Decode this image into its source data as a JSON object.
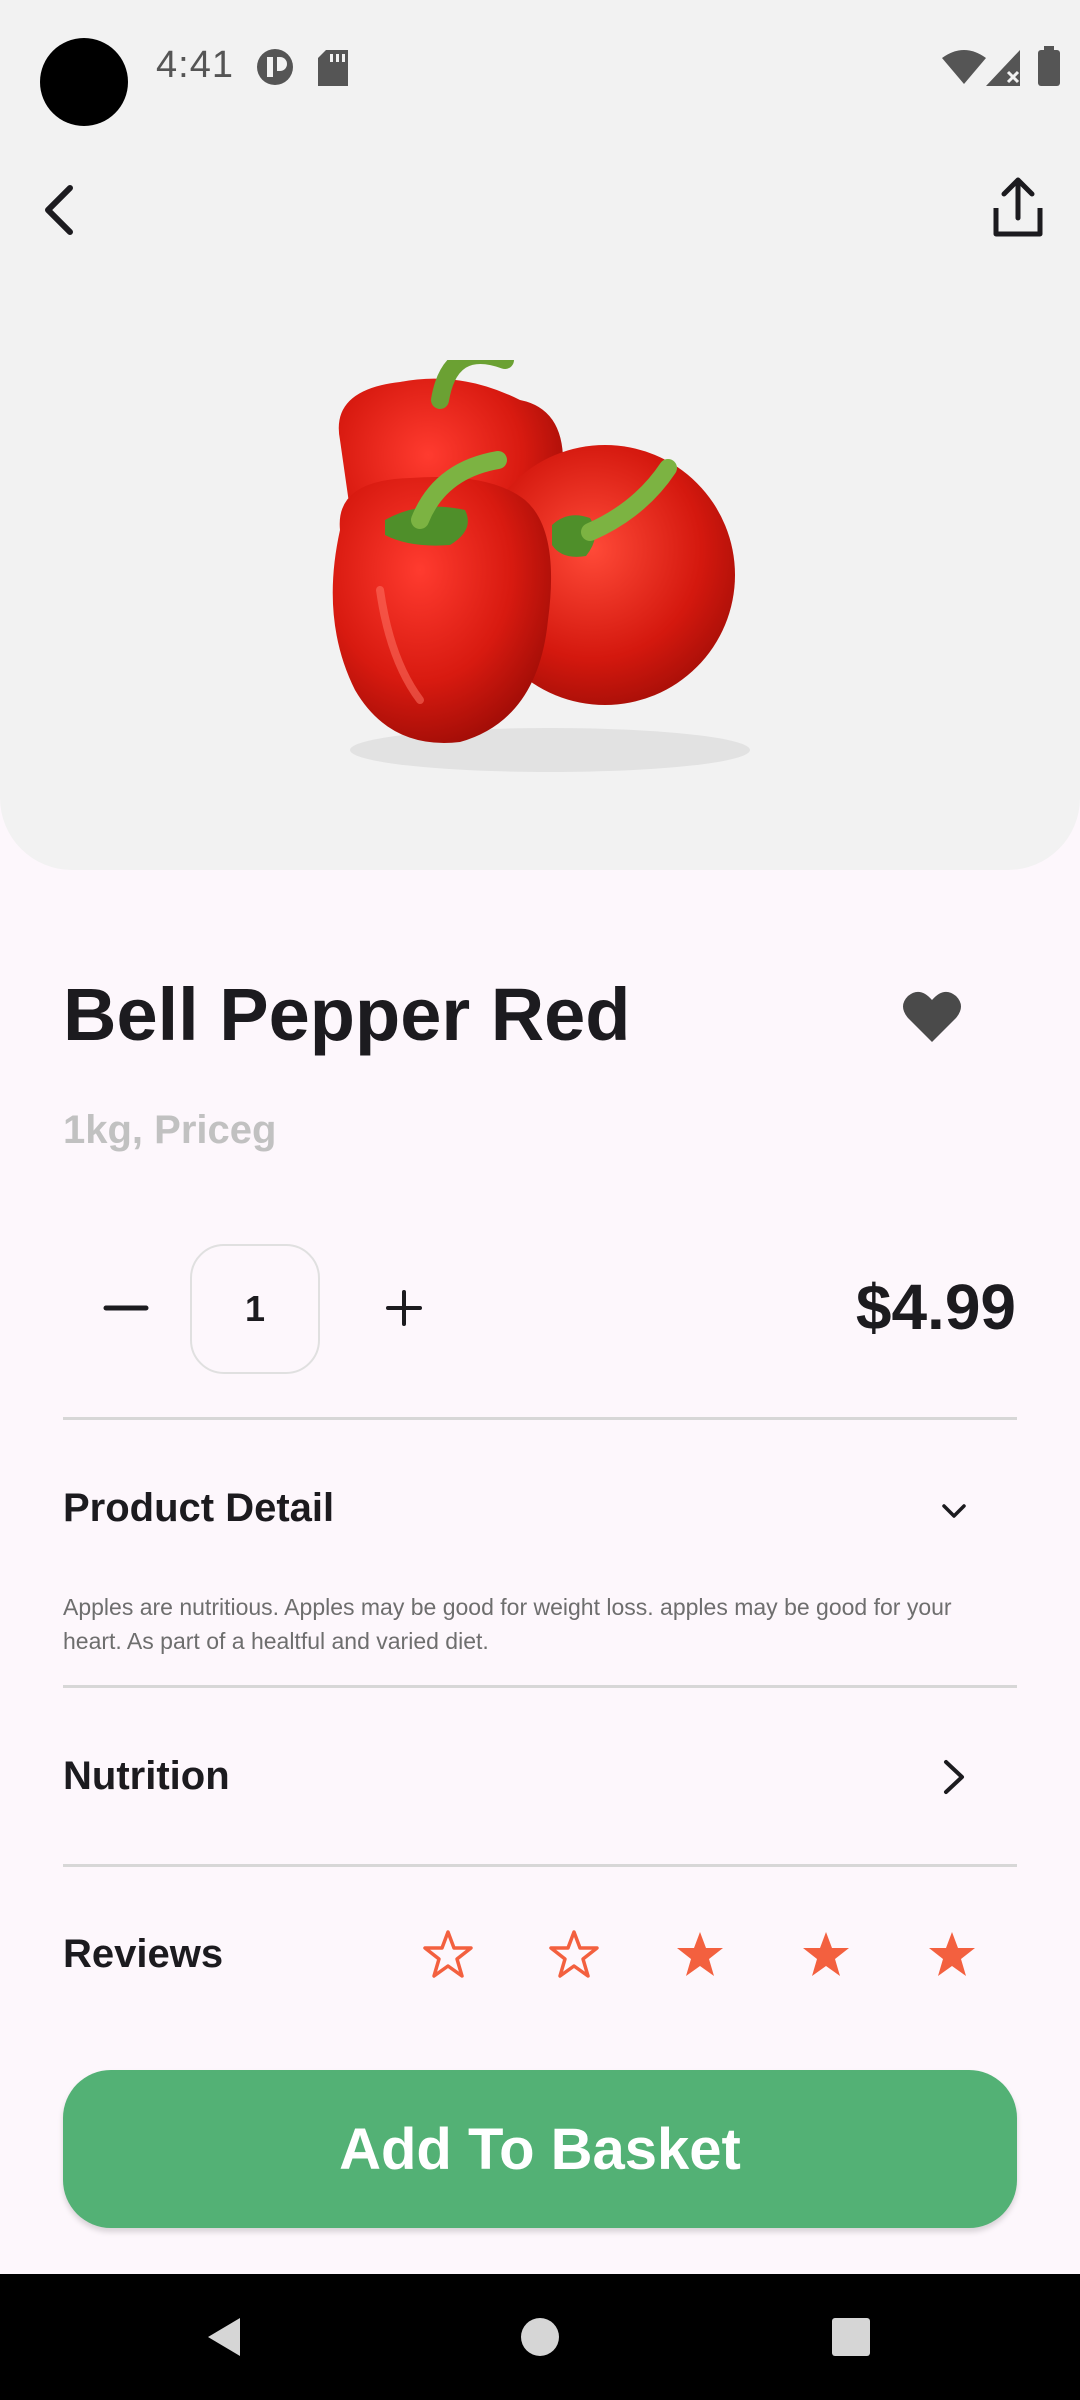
{
  "status_bar": {
    "time": "4:41",
    "icons": [
      "media-icon",
      "sd-card-icon",
      "wifi-icon",
      "signal-icon",
      "battery-icon"
    ]
  },
  "header": {
    "back_icon": "chevron-left-icon",
    "share_icon": "share-icon"
  },
  "product": {
    "name": "Bell Pepper Red",
    "subtitle": "1kg, Priceg",
    "price": "$4.99",
    "favorited": true,
    "quantity": "1",
    "image": "red-bell-peppers"
  },
  "sections": {
    "detail": {
      "title": "Product Detail",
      "text": "Apples are nutritious. Apples may be good for weight loss. apples may be good for your heart. As part of a healtful and varied diet."
    },
    "nutrition": {
      "title": "Nutrition"
    },
    "reviews": {
      "title": "Reviews",
      "rating": 3,
      "max": 5
    }
  },
  "actions": {
    "add_to_basket": "Add To Basket"
  },
  "colors": {
    "accent_green": "#53b175",
    "star_orange": "#f3603f",
    "background": "#fdf7fc",
    "hero_gray": "#f2f2f2"
  },
  "nav_bar": {
    "items": [
      "back-icon",
      "home-icon",
      "recents-icon"
    ]
  }
}
